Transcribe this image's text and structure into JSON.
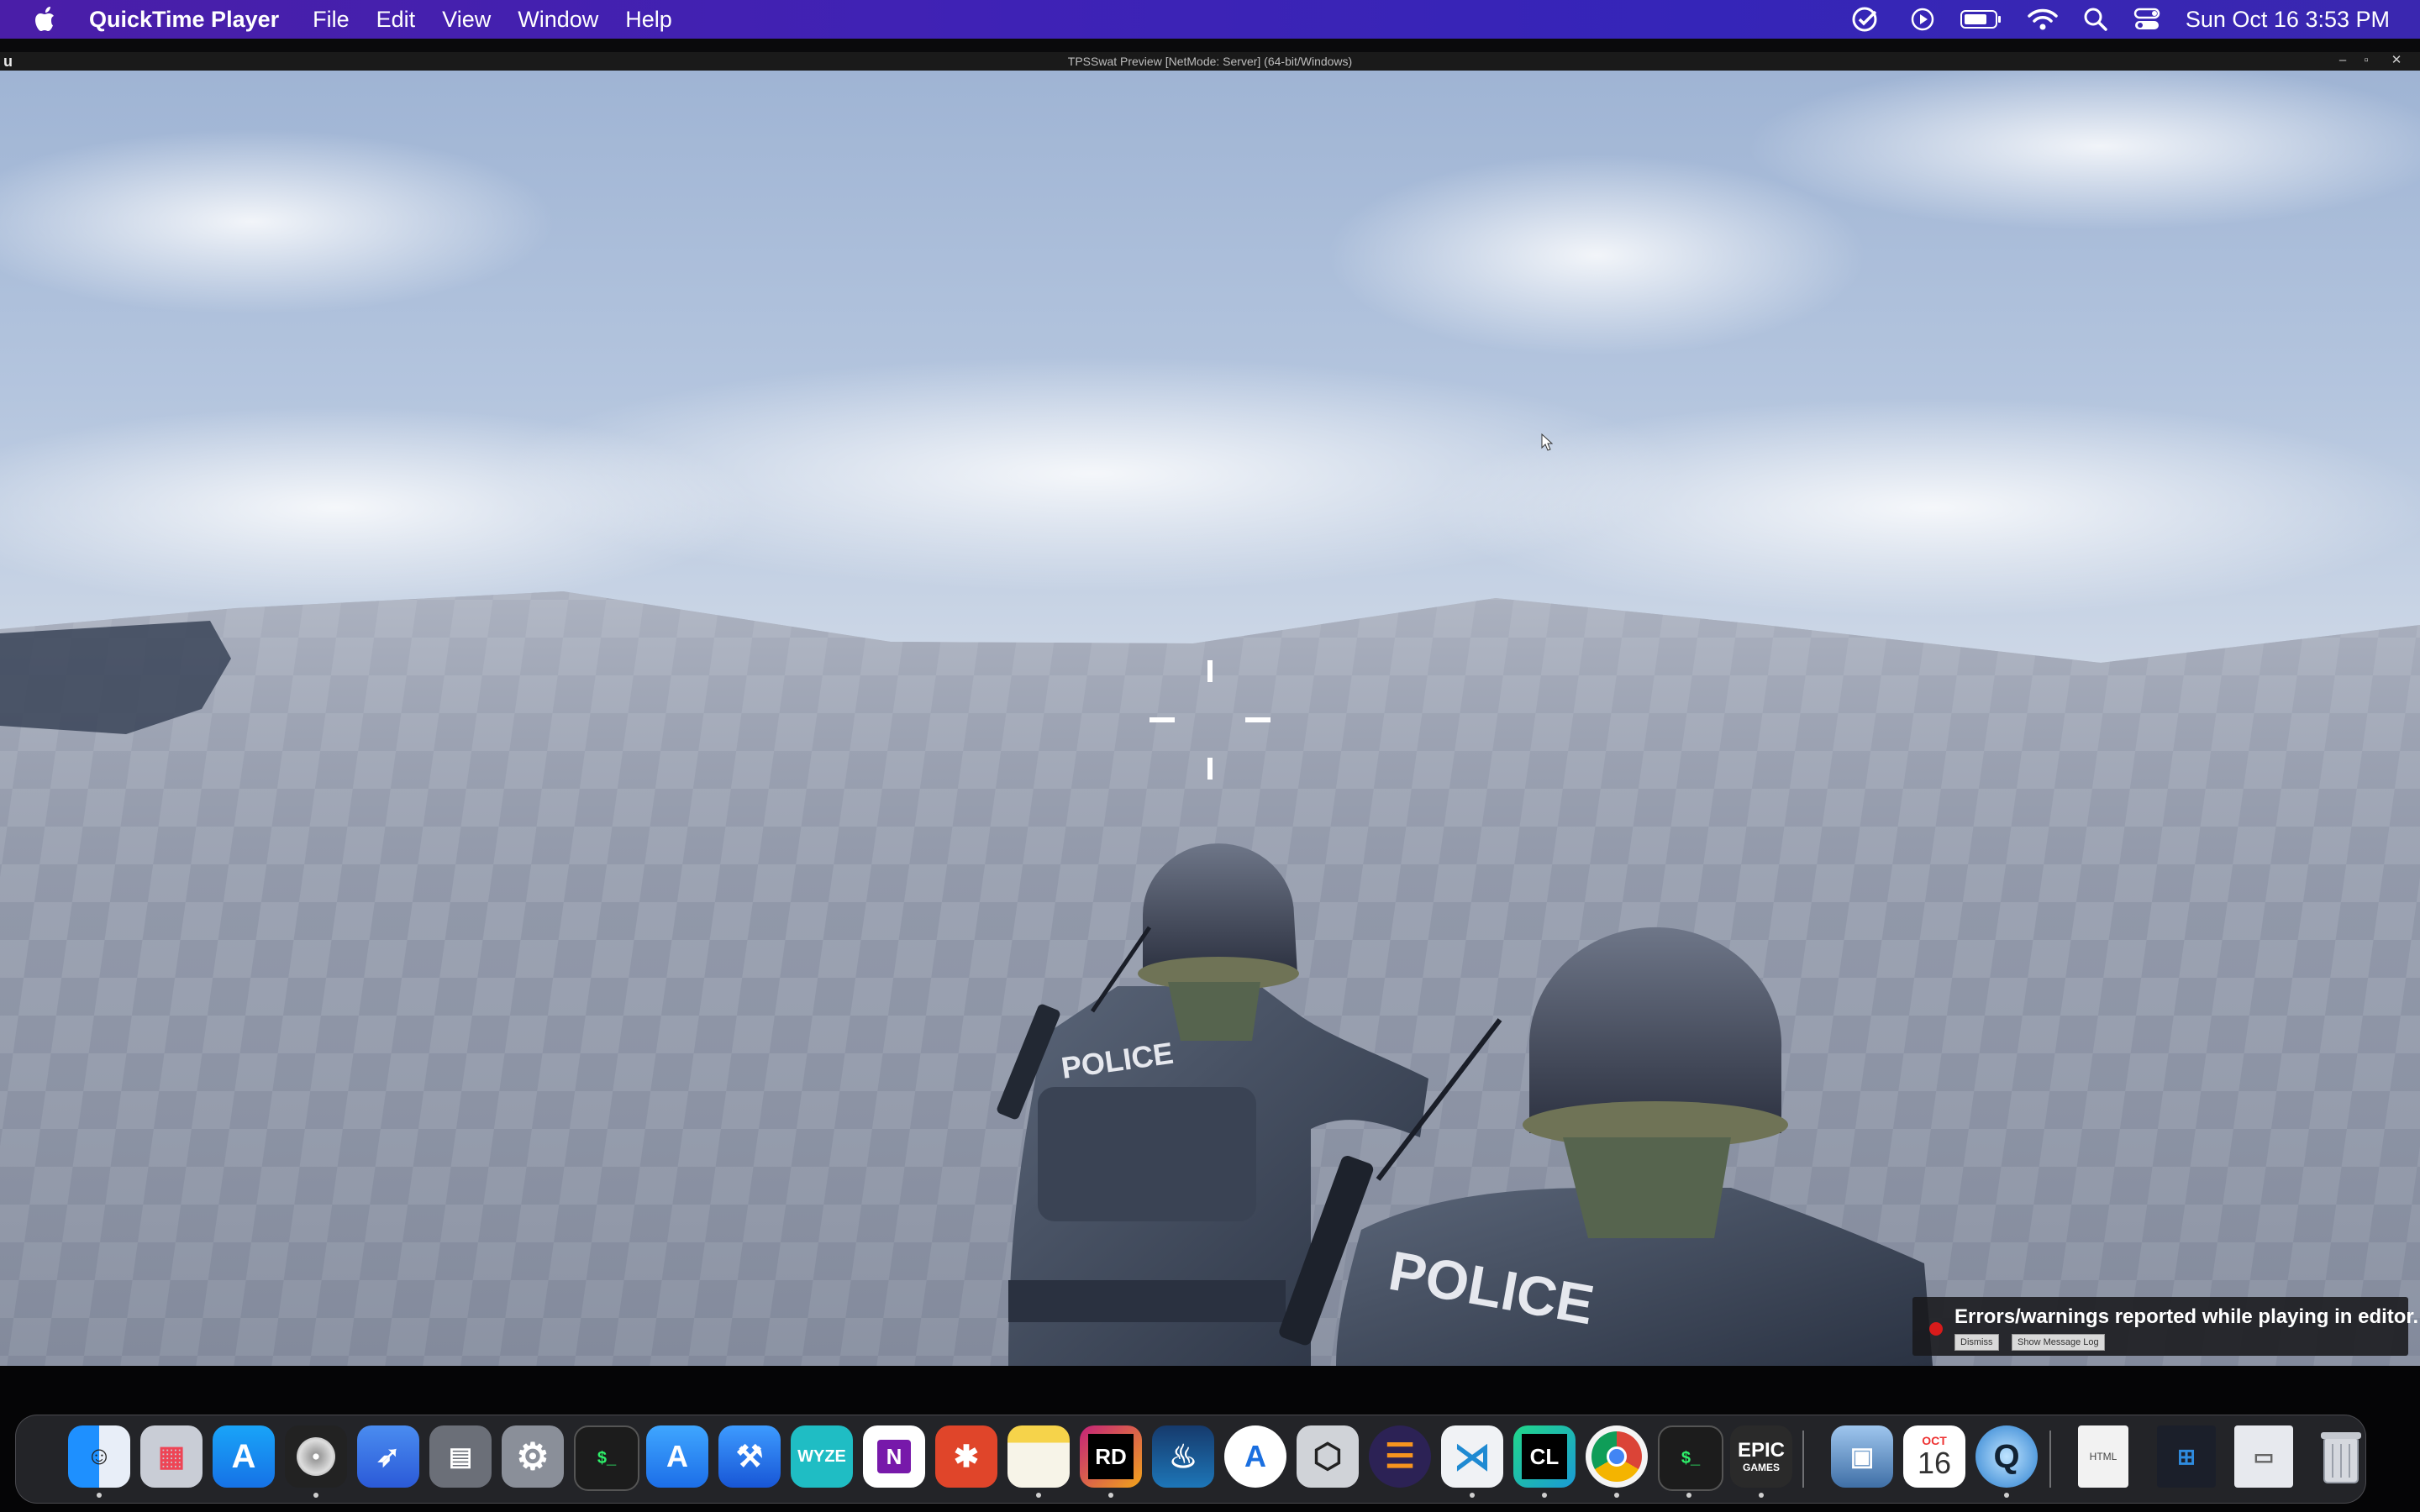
{
  "menubar": {
    "app_name": "QuickTime Player",
    "menus": [
      "File",
      "Edit",
      "View",
      "Window",
      "Help"
    ],
    "status_icons": [
      "check-circle-icon",
      "play-circle-icon",
      "battery-icon",
      "wifi-icon",
      "search-icon",
      "control-center-icon"
    ],
    "clock": "Sun Oct 16  3:53 PM"
  },
  "game_window": {
    "title": "TPSSwat Preview [NetMode: Server]  (64-bit/Windows)",
    "controls": [
      "minimize",
      "maximize",
      "close"
    ]
  },
  "viewport": {
    "jacket_text_left": "POLICE",
    "jacket_text_right": "POLICE",
    "crosshair": "crosshair-icon"
  },
  "toast": {
    "message": "Errors/warnings reported while playing in editor.",
    "dismiss_label": "Dismiss",
    "show_log_label": "Show Message Log"
  },
  "dock": {
    "apps": [
      {
        "name": "Finder",
        "icon": "finder-icon",
        "running": true
      },
      {
        "name": "Launchpad",
        "icon": "launchpad-icon",
        "running": false
      },
      {
        "name": "App Store",
        "icon": "app-store-icon",
        "running": false
      },
      {
        "name": "Logic",
        "icon": "disc-icon",
        "running": true
      },
      {
        "name": "Swift Playgrounds",
        "icon": "swift-icon",
        "running": false
      },
      {
        "name": "Preview",
        "icon": "preview-icon",
        "running": false
      },
      {
        "name": "System Preferences",
        "icon": "gear-icon",
        "running": false
      },
      {
        "name": "Terminal",
        "icon": "terminal-icon",
        "running": false
      },
      {
        "name": "Simulator",
        "icon": "simulator-icon",
        "running": false
      },
      {
        "name": "Xcode",
        "icon": "xcode-icon",
        "running": false
      },
      {
        "name": "Wyze",
        "icon": "wyze-icon",
        "label": "WYZE",
        "running": false
      },
      {
        "name": "OneNote",
        "icon": "onenote-icon",
        "label": "N",
        "running": false
      },
      {
        "name": "Remote Desktop",
        "icon": "remote-desktop-icon",
        "running": false
      },
      {
        "name": "Notes",
        "icon": "notes-icon",
        "running": true
      },
      {
        "name": "Rider",
        "icon": "rider-icon",
        "label": "RD",
        "running": true
      },
      {
        "name": "Steam",
        "icon": "steam-icon",
        "running": false
      },
      {
        "name": "Instruments",
        "icon": "instruments-icon",
        "running": false
      },
      {
        "name": "Unity",
        "icon": "unity-icon",
        "running": false
      },
      {
        "name": "Eclipse",
        "icon": "eclipse-icon",
        "running": false
      },
      {
        "name": "Visual Studio Code",
        "icon": "vscode-icon",
        "running": true
      },
      {
        "name": "CLion",
        "icon": "clion-icon",
        "label": "CL",
        "running": true
      },
      {
        "name": "Chrome",
        "icon": "chrome-icon",
        "running": true
      },
      {
        "name": "Terminal",
        "icon": "terminal-icon",
        "running": true
      },
      {
        "name": "Epic Games",
        "icon": "epic-games-icon",
        "label": "EPIC",
        "sublabel": "GAMES",
        "running": true
      },
      {
        "name": "Preview",
        "icon": "photo-icon",
        "running": false
      },
      {
        "name": "Calendar",
        "icon": "calendar-icon",
        "month": "OCT",
        "day": "16",
        "running": false
      },
      {
        "name": "QuickTime Player",
        "icon": "quicktime-icon",
        "running": true
      }
    ],
    "stacks": [
      {
        "name": "HTML File",
        "icon": "html-file-icon",
        "label": "HTML"
      },
      {
        "name": "Screenshots",
        "icon": "screenshots-icon"
      },
      {
        "name": "Browser Window",
        "icon": "browser-window-icon"
      },
      {
        "name": "Trash",
        "icon": "trash-icon"
      }
    ]
  },
  "colors": {
    "menubar_start": "#4a1ea8",
    "menubar_end": "#3525b8",
    "error_red": "#d81b1b"
  }
}
